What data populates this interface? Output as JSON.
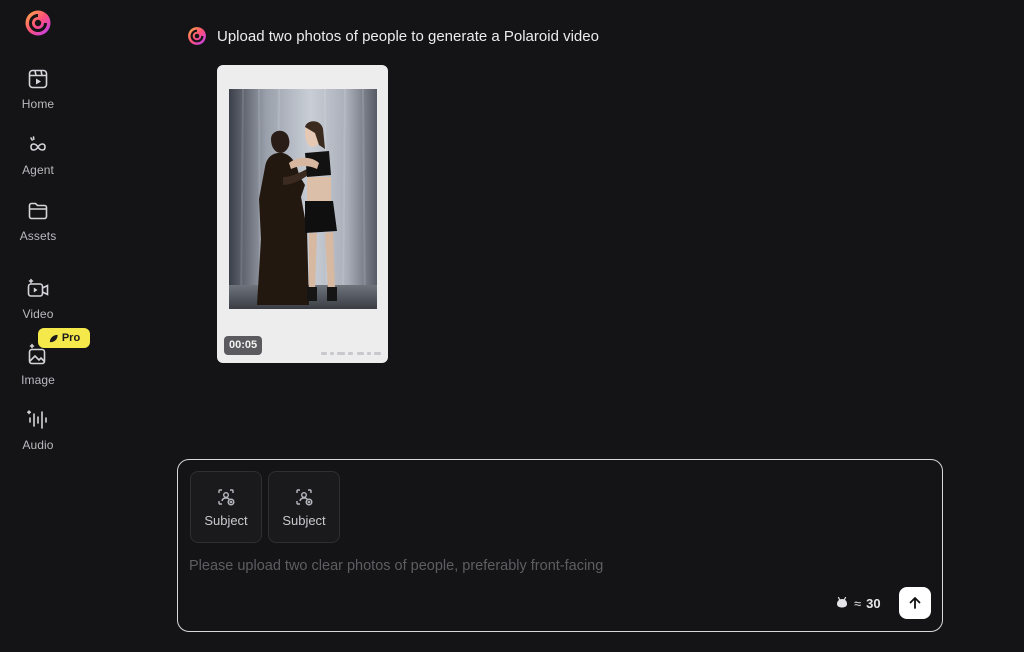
{
  "sidebar": {
    "items": [
      {
        "label": "Home",
        "icon": "home-icon"
      },
      {
        "label": "Agent",
        "icon": "agent-icon"
      },
      {
        "label": "Assets",
        "icon": "folder-icon"
      },
      {
        "label": "Video",
        "icon": "video-icon"
      },
      {
        "label": "Image",
        "icon": "image-icon"
      },
      {
        "label": "Audio",
        "icon": "audio-icon"
      }
    ],
    "pro_badge": "Pro"
  },
  "message": {
    "title": "Upload two photos of people to generate a Polaroid video"
  },
  "result_card": {
    "duration": "00:05"
  },
  "composer": {
    "subject_buttons": [
      "Subject",
      "Subject"
    ],
    "input_placeholder": "Please upload two clear photos of people, preferably front-facing",
    "input_value": "",
    "credits_approx": "≈",
    "credits_value": "30"
  },
  "colors": {
    "background": "#141416",
    "pro_badge": "#f5e84a",
    "logo_gradient": [
      "#ff6a3d",
      "#c23cff"
    ]
  }
}
